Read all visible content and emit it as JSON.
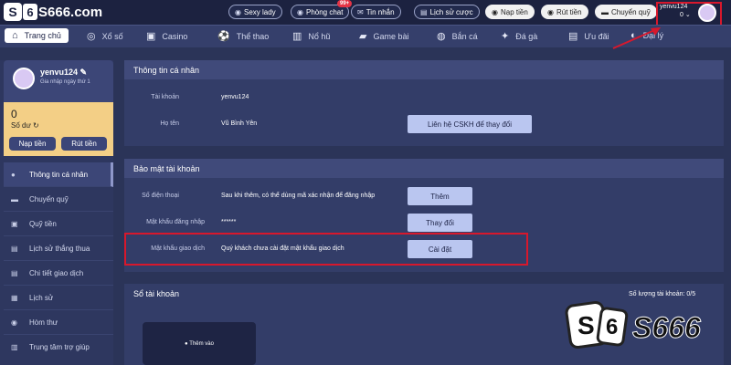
{
  "header": {
    "logo_text": "S666.com",
    "logo_dice": "S",
    "logo_mark": "6",
    "pills": [
      {
        "icon": "sexy-lady-icon",
        "label": "Sexy lady"
      },
      {
        "icon": "chat-room-icon",
        "label": "Phòng chat"
      },
      {
        "icon": "message-icon",
        "label": "Tin nhắn"
      },
      {
        "icon": "bet-history-icon",
        "label": "Lịch sử cược"
      },
      {
        "icon": "deposit-icon",
        "label": "Nạp tiền"
      },
      {
        "icon": "withdraw-icon",
        "label": "Rút tiền"
      },
      {
        "icon": "transfer-icon",
        "label": "Chuyển quỹ"
      }
    ],
    "chat_badge": "99+",
    "username": "yenvu124",
    "balance": "0"
  },
  "nav": {
    "items": [
      {
        "icon": "home-icon",
        "label": "Trang chủ"
      },
      {
        "icon": "lottery-icon",
        "label": "Xổ số"
      },
      {
        "icon": "casino-icon",
        "label": "Casino"
      },
      {
        "icon": "sports-icon",
        "label": "Thể thao"
      },
      {
        "icon": "slots-icon",
        "label": "Nổ hũ"
      },
      {
        "icon": "card-game-icon",
        "label": "Game bài"
      },
      {
        "icon": "fishing-icon",
        "label": "Bắn cá"
      },
      {
        "icon": "cockfight-icon",
        "label": "Đá gà"
      },
      {
        "icon": "promotion-icon",
        "label": "Ưu đãi"
      },
      {
        "icon": "agent-icon",
        "label": "Đại lý"
      }
    ]
  },
  "sidebar": {
    "username": "yenvu124",
    "join_text": "Gia nhập ngày thứ 1",
    "balance_value": "0",
    "balance_label": "Số dư",
    "deposit_label": "Nạp tiền",
    "withdraw_label": "Rút tiền",
    "menu": [
      {
        "icon": "user-icon",
        "label": "Thông tin cá nhân"
      },
      {
        "icon": "transfer-icon",
        "label": "Chuyển quỹ"
      },
      {
        "icon": "fund-icon",
        "label": "Quỹ tiền"
      },
      {
        "icon": "win-loss-icon",
        "label": "Lịch sử thắng thua"
      },
      {
        "icon": "transaction-icon",
        "label": "Chi tiết giao dịch"
      },
      {
        "icon": "history-icon",
        "label": "Lịch sử"
      },
      {
        "icon": "mailbox-icon",
        "label": "Hòm thư"
      },
      {
        "icon": "help-icon",
        "label": "Trung tâm trợ giúp"
      }
    ]
  },
  "personal": {
    "title": "Thông tin cá nhân",
    "account_label": "Tài khoản",
    "account_value": "yenvu124",
    "name_label": "Họ tên",
    "name_value": "Vũ Bình Yên",
    "contact_button": "Liên hệ CSKH để thay đổi"
  },
  "security": {
    "title": "Bảo mật tài khoản",
    "phone_label": "Số điện thoại",
    "phone_value": "Sau khi thêm, có thể dùng mã xác nhận để đăng nhập",
    "phone_button": "Thêm",
    "password_label": "Mật khẩu đăng nhập",
    "password_value": "******",
    "password_button": "Thay đổi",
    "trade_label": "Mật khẩu giao dịch",
    "trade_value": "Quý khách chưa cài đặt mật khẩu giao dịch",
    "trade_button": "Cài đặt"
  },
  "accounts": {
    "title": "Sổ tài khoản",
    "count_label": "Số lượng tài khoản: 0/5",
    "add_label": "Thêm vào"
  },
  "brand": {
    "text": "S666",
    "dice": "S",
    "mark": "6"
  },
  "colors": {
    "accent_red": "#d8182c",
    "nav_bg": "#353f6b",
    "button_blue": "#bac6f0",
    "balance_bg": "#f3cf86"
  }
}
